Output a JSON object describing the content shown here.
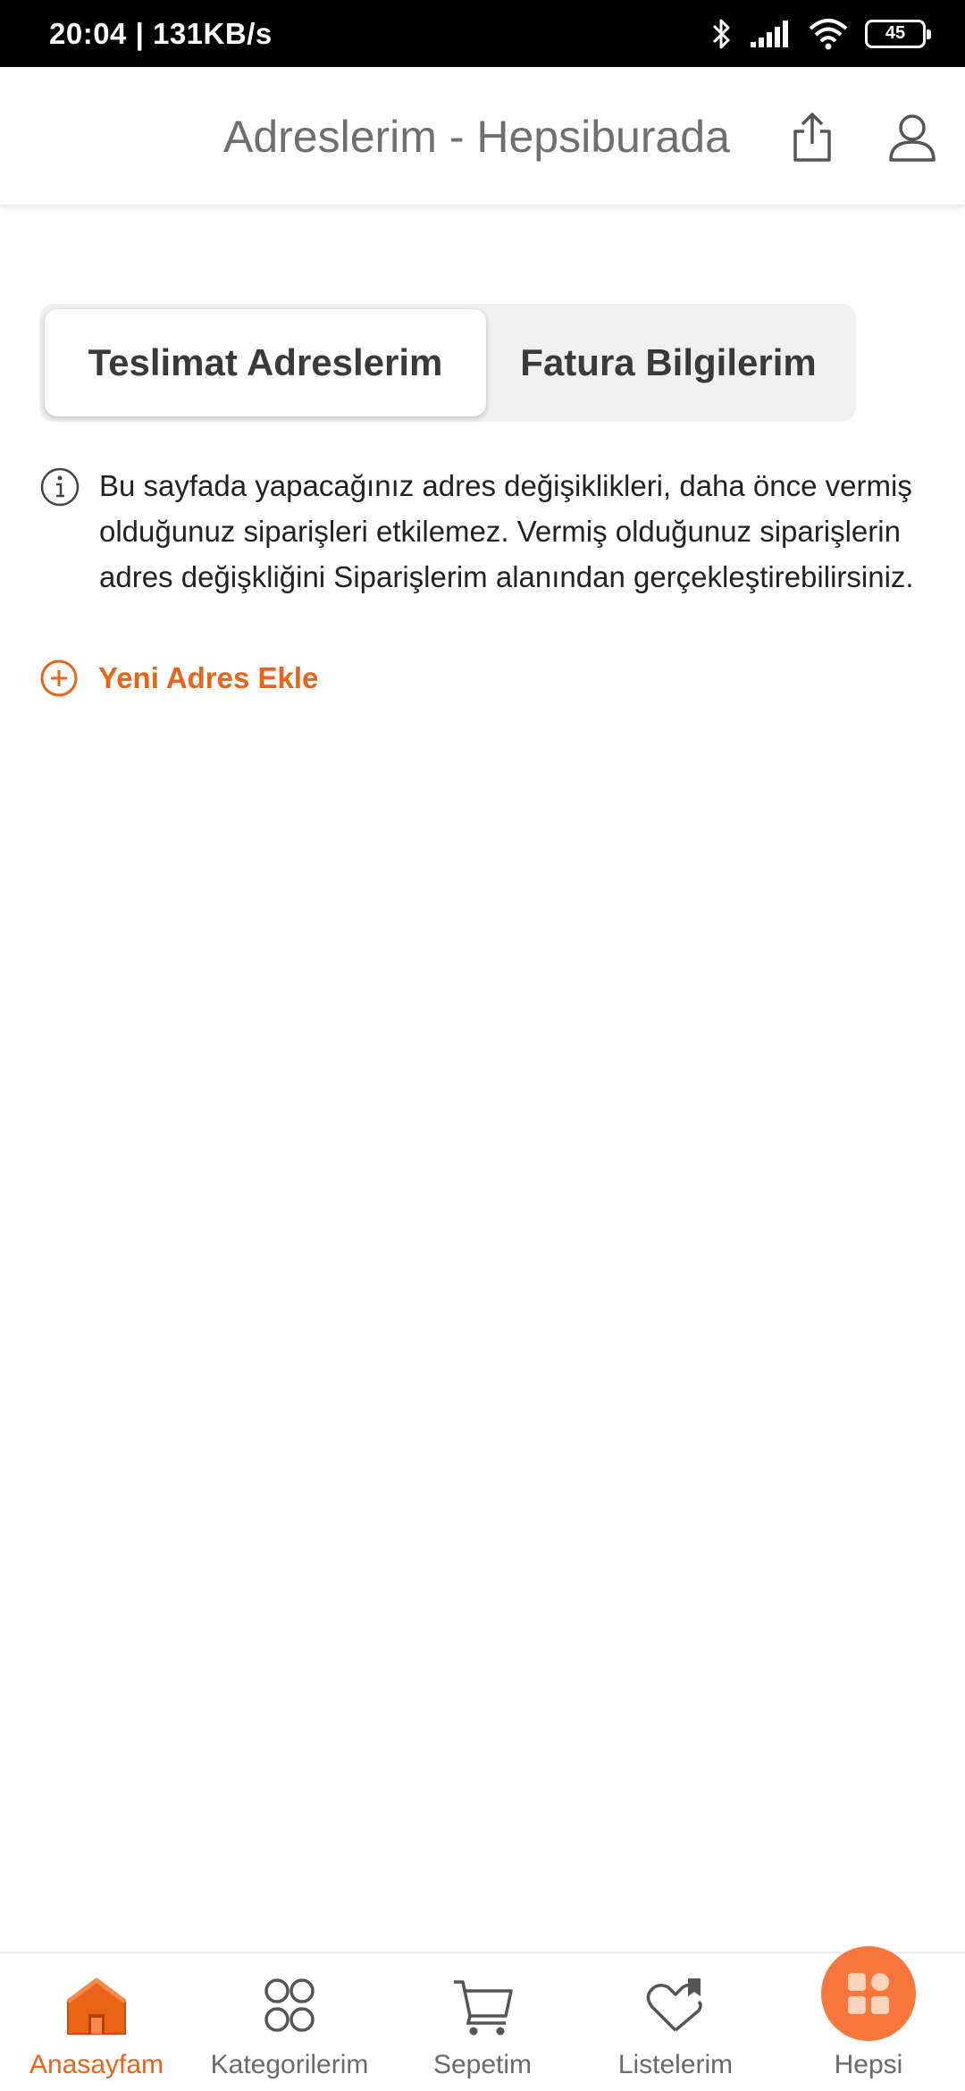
{
  "status_bar": {
    "time_speed": "20:04 | 131KB/s",
    "battery": "45"
  },
  "header": {
    "title": "Adreslerim - Hepsiburada",
    "share_icon": "share-icon",
    "account_icon": "user-icon"
  },
  "tabs": [
    {
      "label": "Teslimat Adreslerim",
      "active": true
    },
    {
      "label": "Fatura Bilgilerim",
      "active": false
    }
  ],
  "info": {
    "icon": "info-icon",
    "text": "Bu sayfada yapacağınız adres değişiklikleri, daha önce vermiş olduğunuz siparişleri etkilemez. Vermiş olduğunuz siparişlerin adres değişkliğini Siparişlerim alanından gerçekleştirebilirsiniz."
  },
  "add_address": {
    "icon": "plus-circle-icon",
    "label": "Yeni Adres Ekle"
  },
  "bottom_nav": [
    {
      "label": "Anasayfam",
      "icon": "home-icon",
      "active": true
    },
    {
      "label": "Kategorilerim",
      "icon": "categories-icon",
      "active": false
    },
    {
      "label": "Sepetim",
      "icon": "cart-icon",
      "active": false
    },
    {
      "label": "Listelerim",
      "icon": "list-heart-icon",
      "active": false
    },
    {
      "label": "Hepsi",
      "icon": "apps-icon",
      "active": false
    }
  ],
  "colors": {
    "accent": "#ea6417",
    "hepsi_button": "#f8763b",
    "tab_background": "#f0f0f0",
    "header_title": "#6f6f6f"
  }
}
